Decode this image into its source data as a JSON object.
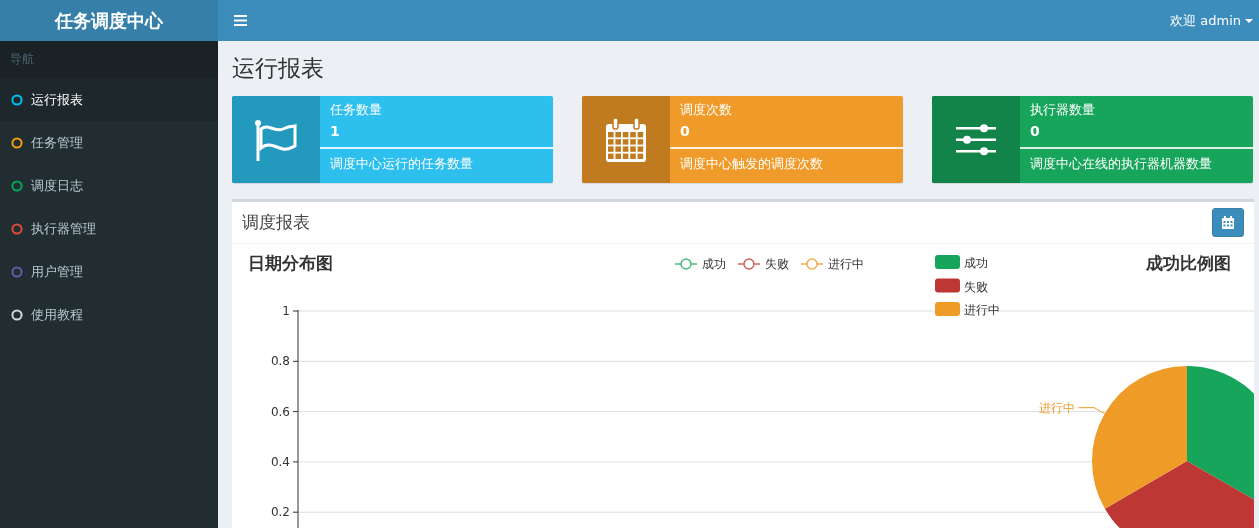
{
  "logo": "任务调度中心",
  "topbar": {
    "user": "欢迎 admin"
  },
  "sidebar": {
    "header": "导航",
    "items": [
      {
        "label": "运行报表",
        "color": "#00c0ef",
        "selected": true
      },
      {
        "label": "任务管理",
        "color": "#f39c12",
        "selected": false
      },
      {
        "label": "调度日志",
        "color": "#00a65a",
        "selected": false
      },
      {
        "label": "执行器管理",
        "color": "#dd4b39",
        "selected": false
      },
      {
        "label": "用户管理",
        "color": "#605ca8",
        "selected": false
      },
      {
        "label": "使用教程",
        "color": "#d2d6de",
        "selected": false
      }
    ]
  },
  "page_title": "运行报表",
  "cards": [
    {
      "kind": "flag",
      "color": "#2dbfed",
      "title": "任务数量",
      "value": "1",
      "description": "调度中心运行的任务数量"
    },
    {
      "kind": "calendar",
      "color": "#f09a29",
      "title": "调度次数",
      "value": "0",
      "description": "调度中心触发的调度次数"
    },
    {
      "kind": "sliders",
      "color": "#17a55b",
      "title": "执行器数量",
      "value": "0",
      "description": "调度中心在线的执行器机器数量"
    }
  ],
  "panel": {
    "title": "调度报表",
    "line_chart": {
      "chart_data": {
        "type": "line",
        "title": "日期分布图",
        "legend": "top",
        "grid": true,
        "ylim": [
          0,
          1
        ],
        "yticks": [
          {
            "value": 0.2,
            "label": "0.2"
          },
          {
            "value": 0.4,
            "label": "0.4"
          },
          {
            "value": 0.6,
            "label": "0.6"
          },
          {
            "value": 0.8,
            "label": "0.8"
          },
          {
            "value": 1,
            "label": "1"
          }
        ],
        "series": [
          {
            "name": "成功",
            "color": "#4cbb7f"
          },
          {
            "name": "失败",
            "color": "#d46060"
          },
          {
            "name": "进行中",
            "color": "#f0ad4e"
          }
        ]
      }
    },
    "pie_chart": {
      "chart_data": {
        "type": "pie",
        "title": "成功比例图",
        "legend": "top-left",
        "categories": [
          "成功",
          "失败",
          "进行中"
        ],
        "colors": [
          "#17a55b",
          "#bd3734",
          "#ef9b28"
        ],
        "values": [
          33.3,
          33.3,
          33.4
        ],
        "annotations": [
          {
            "x": "进行中",
            "text": "进行中"
          }
        ]
      }
    }
  }
}
